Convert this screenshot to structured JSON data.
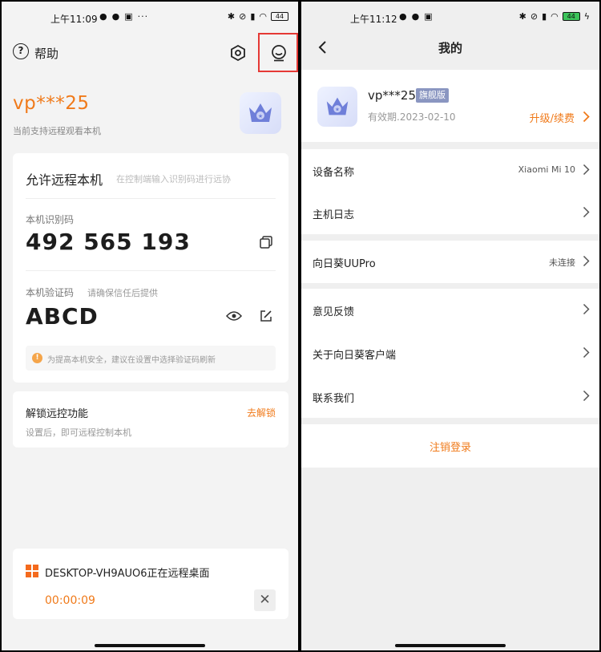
{
  "left": {
    "status": {
      "time": "上午11:09",
      "battery": "44"
    },
    "header": {
      "help_label": "帮助"
    },
    "account": {
      "username": "vp***25",
      "subtitle": "当前支持远程观看本机"
    },
    "remote_card": {
      "title": "允许远程本机",
      "hint": "在控制端输入识别码进行远协",
      "id_label": "本机识别码",
      "id_value": "492 565 193",
      "verify_label": "本机验证码",
      "verify_hint": "请确保信任后提供",
      "verify_value": "ABCD",
      "tip": "为提高本机安全，建议在设置中选择验证码刷新"
    },
    "unlock_card": {
      "title": "解锁远控功能",
      "subtitle": "设置后，即可远程控制本机",
      "link": "去解锁"
    },
    "session_card": {
      "title": "DESKTOP-VH9AUO6正在远程桌面",
      "timer": "00:00:09"
    }
  },
  "right": {
    "status": {
      "time": "上午11:12",
      "battery": "44"
    },
    "header": {
      "title": "我的"
    },
    "profile": {
      "username": "vp***25",
      "tier": "旗舰版",
      "expiry": "有效期.2023-02-10",
      "upgrade": "升级/续费"
    },
    "rows": [
      {
        "label": "设备名称",
        "value": "Xiaomi Mi 10"
      },
      {
        "label": "主机日志",
        "value": ""
      },
      {
        "label": "向日葵UUPro",
        "value": "未连接"
      },
      {
        "label": "意见反馈",
        "value": ""
      },
      {
        "label": "关于向日葵客户端",
        "value": ""
      },
      {
        "label": "联系我们",
        "value": ""
      }
    ],
    "logout": "注销登录"
  },
  "colors": {
    "accent": "#f07a1a",
    "highlight_box": "#e53935",
    "tier_tag": "#8a96c1"
  }
}
